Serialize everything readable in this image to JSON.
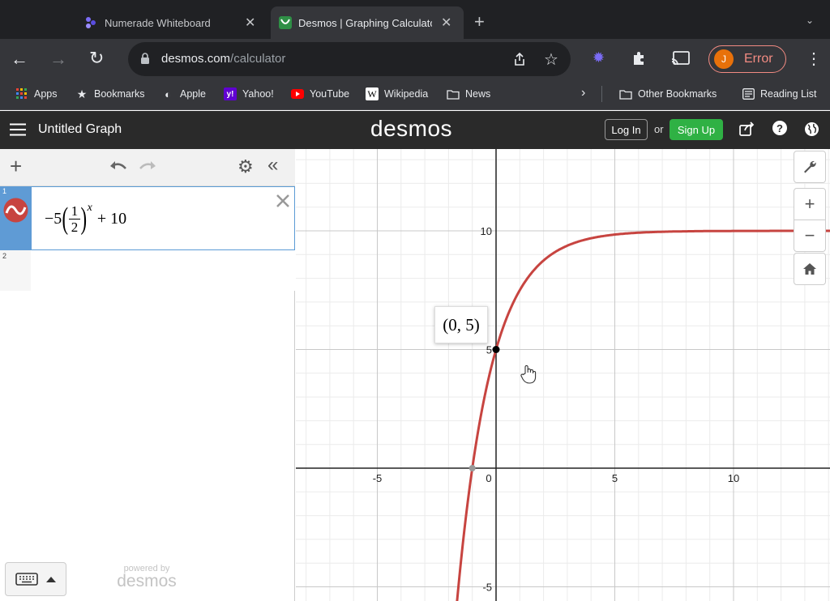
{
  "tabs": [
    {
      "title": "Numerade Whiteboard"
    },
    {
      "title": "Desmos | Graphing Calculato"
    }
  ],
  "address": {
    "domain": "desmos.com",
    "path": "/calculator"
  },
  "profile": {
    "initial": "J",
    "label": "Error"
  },
  "bookmarks": [
    "Apps",
    "Bookmarks",
    "Apple",
    "Yahoo!",
    "YouTube",
    "Wikipedia",
    "News"
  ],
  "bookmarks_right": [
    "Other Bookmarks",
    "Reading List"
  ],
  "desmos": {
    "graph_title": "Untitled Graph",
    "logo": "desmos",
    "login": "Log In",
    "or": "or",
    "signup": "Sign Up",
    "powered_by": "powered by",
    "powered_logo": "desmos"
  },
  "expressions": [
    {
      "index": "1",
      "color": "#c74440"
    },
    {
      "index": "2"
    }
  ],
  "graph": {
    "point_label": "(0, 5)",
    "x_ticks": [
      "-5",
      "0",
      "5",
      "10"
    ],
    "y_ticks": [
      "10",
      "5",
      "-5"
    ],
    "curve_color": "#c74440"
  }
}
